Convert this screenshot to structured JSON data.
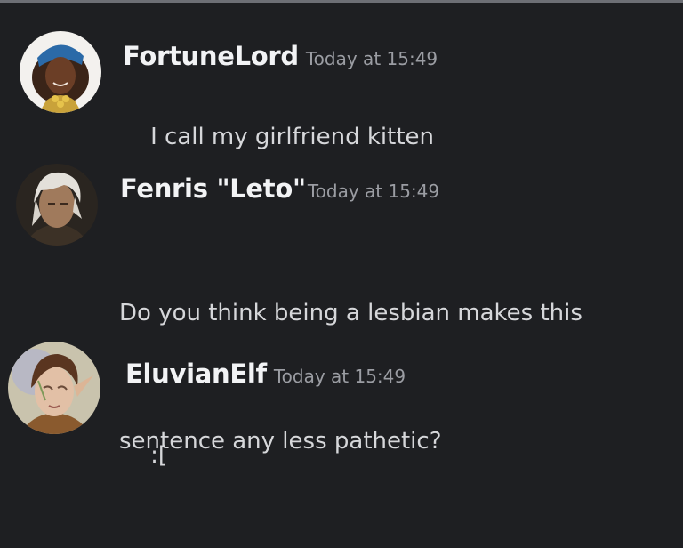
{
  "messages": [
    {
      "avatar_icon": "user-avatar-fortunelord",
      "username": "FortuneLord",
      "timestamp": "Today at 15:49",
      "content": "I call my girlfriend kitten"
    },
    {
      "avatar_icon": "user-avatar-fenris",
      "username": "Fenris \"Leto\"",
      "timestamp": "Today at 15:49",
      "content_lines": [
        "Do you think being a lesbian makes this",
        "sentence any less pathetic?"
      ]
    },
    {
      "avatar_icon": "user-avatar-eluvianelf",
      "username": "EluvianElf",
      "timestamp": "Today at 15:49",
      "content": ":["
    }
  ],
  "colors": {
    "background": "#1e1f22",
    "username": "#f2f3f5",
    "timestamp": "#9b9da3",
    "content": "#d6d7da"
  }
}
